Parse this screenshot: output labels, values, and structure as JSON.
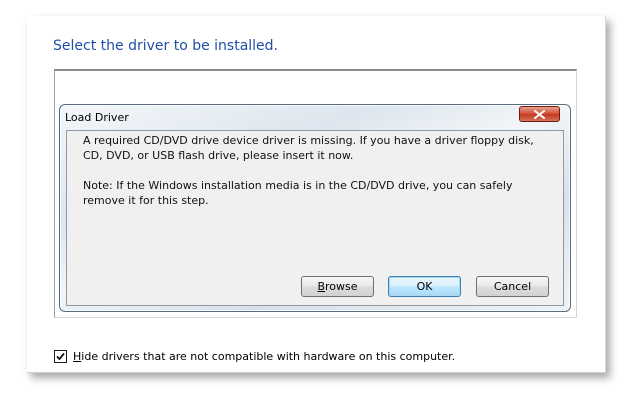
{
  "page": {
    "title": "Select the driver to be installed.",
    "hide_checkbox": {
      "checked": true,
      "label_accel": "H",
      "label_rest": "ide drivers that are not compatible with hardware on this computer."
    }
  },
  "dialog": {
    "title": "Load Driver",
    "close_icon": "close-x-icon",
    "message_1": "A required CD/DVD drive device driver is missing. If you have a driver floppy disk, CD, DVD, or USB flash drive, please insert it now.",
    "message_2": "Note: If the Windows installation media is in the CD/DVD drive, you can safely remove it for this step.",
    "buttons": {
      "browse_accel": "B",
      "browse_rest": "rowse",
      "ok": "OK",
      "cancel": "Cancel"
    }
  },
  "colors": {
    "title_blue": "#1f4fa6",
    "close_red": "#c03a1f",
    "ok_highlight": "#3c7fb1"
  }
}
